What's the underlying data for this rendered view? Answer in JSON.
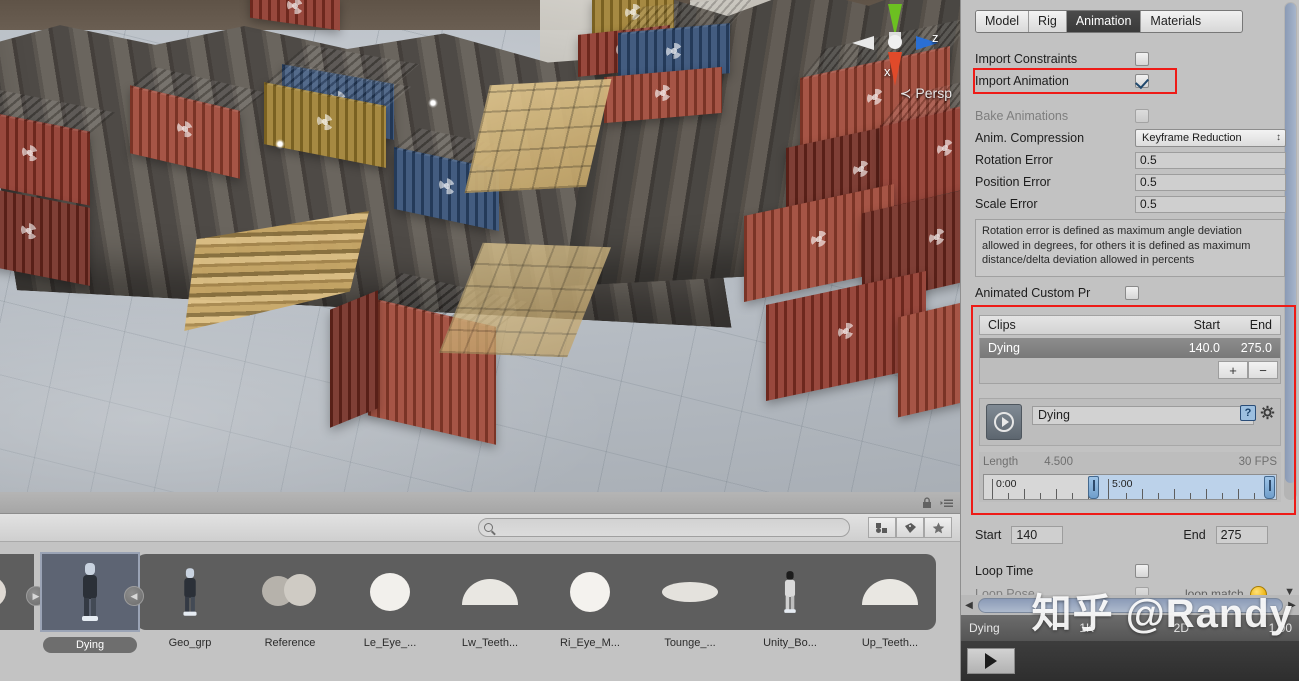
{
  "scene": {
    "gizmo": {
      "x_axis": "x",
      "z_axis": "z",
      "projection": "Persp"
    }
  },
  "project_panel": {
    "search_placeholder": "",
    "filter_buttons": [
      "asset-filter-icon",
      "label-filter-icon",
      "favorite-filter-icon"
    ],
    "lock_icon": "lock-icon",
    "menu_icon": "hamburger-menu-icon",
    "assets": [
      {
        "name": "Dying",
        "selected": true,
        "thumb": "character-figure"
      },
      {
        "name": "Geo_grp",
        "selected": false,
        "thumb": "character-figure"
      },
      {
        "name": "Reference",
        "selected": false,
        "thumb": "double-blob"
      },
      {
        "name": "Le_Eye_...",
        "selected": false,
        "thumb": "blob"
      },
      {
        "name": "Lw_Teeth...",
        "selected": false,
        "thumb": "arc"
      },
      {
        "name": "Ri_Eye_M...",
        "selected": false,
        "thumb": "blob"
      },
      {
        "name": "Tounge_...",
        "selected": false,
        "thumb": "flat-blob"
      },
      {
        "name": "Unity_Bo...",
        "selected": false,
        "thumb": "character-figure"
      },
      {
        "name": "Up_Teeth...",
        "selected": false,
        "thumb": "arc"
      }
    ]
  },
  "inspector": {
    "tabs": [
      {
        "label": "Model",
        "active": false
      },
      {
        "label": "Rig",
        "active": false
      },
      {
        "label": "Animation",
        "active": true
      },
      {
        "label": "Materials",
        "active": false
      }
    ],
    "import_constraints": {
      "label": "Import Constraints",
      "checked": false
    },
    "import_animation": {
      "label": "Import Animation",
      "checked": true,
      "highlighted": true
    },
    "bake_animations": {
      "label": "Bake Animations",
      "checked": false,
      "disabled": true
    },
    "anim_compression": {
      "label": "Anim. Compression",
      "value": "Keyframe Reduction"
    },
    "rotation_error": {
      "label": "Rotation Error",
      "value": "0.5"
    },
    "position_error": {
      "label": "Position Error",
      "value": "0.5"
    },
    "scale_error": {
      "label": "Scale Error",
      "value": "0.5"
    },
    "help_text": "Rotation error is defined as maximum angle deviation allowed in degrees, for others it is defined as maximum distance/delta deviation allowed in percents",
    "animated_custom_props": {
      "label": "Animated Custom Pr",
      "checked": false
    },
    "clips": {
      "header": {
        "name": "Clips",
        "start": "Start",
        "end": "End"
      },
      "rows": [
        {
          "name": "Dying",
          "start": "140.0",
          "end": "275.0",
          "selected": true
        }
      ],
      "add_label": "+",
      "remove_label": "−"
    },
    "clip_editor": {
      "name_value": "Dying",
      "play_icon": "play-circle-icon",
      "help_icon": "help-icon",
      "settings_icon": "gear-icon"
    },
    "timeline": {
      "length_label": "Length",
      "length_value": "4.500",
      "fps_label": "30 FPS",
      "tick_start": "0:00",
      "tick_mid": "5:00"
    },
    "start_end": {
      "start_label": "Start",
      "start_value": "140",
      "end_label": "End",
      "end_value": "275"
    },
    "loop_time": {
      "label": "Loop Time",
      "checked": false
    },
    "loop_pose": {
      "label": "Loop Pose",
      "checked": false,
      "disabled": true
    },
    "loop_match": {
      "label": "loop match",
      "state_color": "#f0b81a"
    }
  },
  "preview": {
    "clip_name": "Dying",
    "info_left": "1K",
    "info_mid": "2D",
    "speed": "1.00",
    "play_icon": "play-icon"
  },
  "watermark": {
    "text": "知乎 @Randy"
  },
  "colors": {
    "accent_red": "#ee1b17",
    "panel_bg": "#c2c2c2",
    "selected_row": "#8d8d8d",
    "timeline_range": "#bcd2ea",
    "loop_match": "#f0b81a"
  }
}
